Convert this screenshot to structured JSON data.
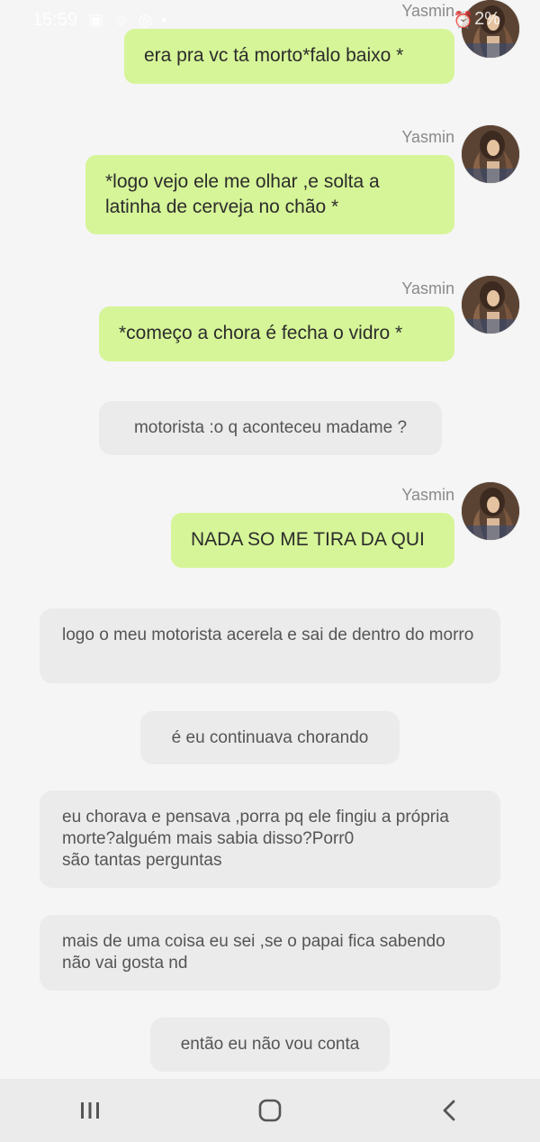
{
  "status_bar": {
    "time": "15:59",
    "battery": "2%"
  },
  "conversation": {
    "messages": [
      {
        "type": "user",
        "sender": "Yasmin",
        "text": "era pra vc tá morto*falo baixo *"
      },
      {
        "type": "user",
        "sender": "Yasmin",
        "text": "*logo vejo ele me olhar ,e solta a latinha de cerveja no chão *"
      },
      {
        "type": "user",
        "sender": "Yasmin",
        "text": "*começo a chora é fecha o vidro *"
      },
      {
        "type": "narration",
        "text": "motorista :o q aconteceu madame ?"
      },
      {
        "type": "user",
        "sender": "Yasmin",
        "text": "NADA SO ME TIRA DA QUI"
      },
      {
        "type": "narration",
        "text": "logo o meu motorista acerela e sai de dentro do morro"
      },
      {
        "type": "narration",
        "text": "é eu continuava chorando"
      },
      {
        "type": "narration",
        "text": "eu chorava e pensava ,porra pq ele fingiu a própria morte?alguém mais sabia disso?Porr0\nsão tantas perguntas"
      },
      {
        "type": "narration",
        "text": "mais de uma coisa eu sei ,se o papai fica sabendo não vai gosta nd"
      },
      {
        "type": "narration",
        "text": "então eu não vou conta"
      }
    ]
  },
  "colors": {
    "user_bubble": "#d6f598",
    "narration_bubble": "#ebebeb",
    "background": "#f5f5f5",
    "sender_name": "#8a8a8a"
  },
  "icons": {
    "nav_recent": "recent-apps-icon",
    "nav_home": "home-icon",
    "nav_back": "back-icon"
  }
}
